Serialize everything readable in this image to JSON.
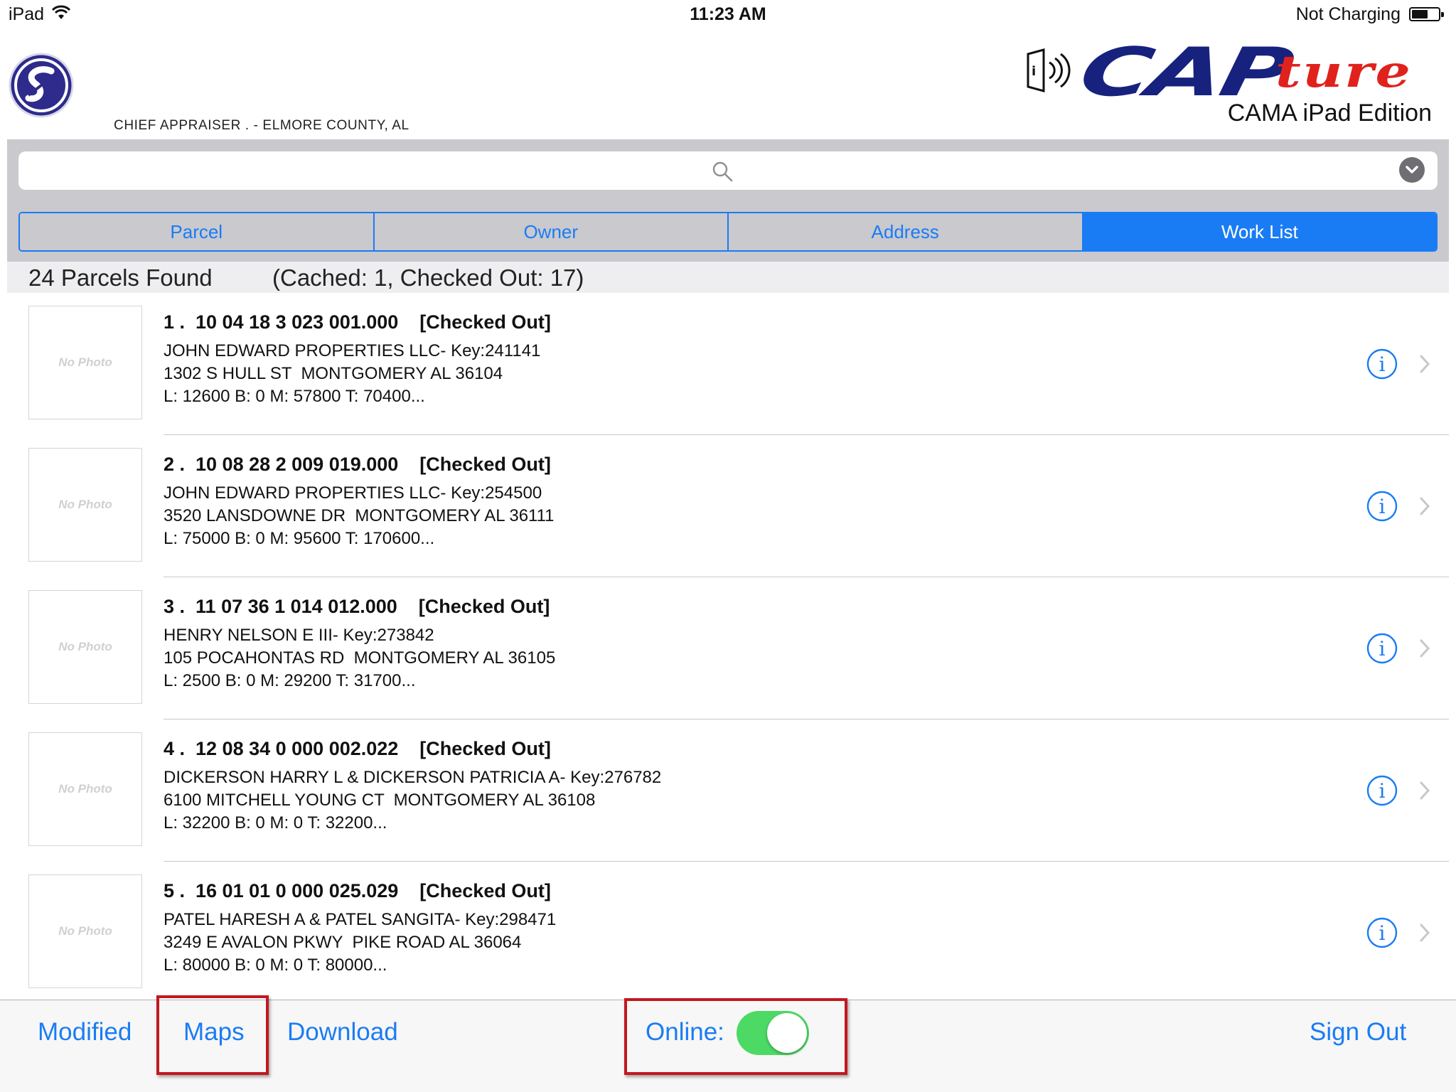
{
  "status_bar": {
    "device": "iPad",
    "time": "11:23 AM",
    "charging": "Not Charging"
  },
  "header": {
    "org_name": "CHIEF APPRAISER . - ELMORE COUNTY, AL",
    "brand_primary": "CAP",
    "brand_script": "ture",
    "edition": "CAMA iPad Edition"
  },
  "search": {
    "placeholder": ""
  },
  "tabs": [
    {
      "label": "Parcel",
      "active": false
    },
    {
      "label": "Owner",
      "active": false
    },
    {
      "label": "Address",
      "active": false
    },
    {
      "label": "Work List",
      "active": true
    }
  ],
  "results": {
    "count_text": "24  Parcels Found",
    "cache_text": "(Cached: 1, Checked Out: 17)"
  },
  "parcels": [
    {
      "title": "1 .  10 04 18 3 023 001.000    [Checked Out]",
      "owner": "JOHN EDWARD PROPERTIES LLC- Key:241141",
      "address": "1302 S HULL ST  MONTGOMERY AL 36104",
      "values": "L: 12600 B: 0 M: 57800 T: 70400...",
      "photo": "No Photo"
    },
    {
      "title": "2 .  10 08 28 2 009 019.000    [Checked Out]",
      "owner": "JOHN EDWARD PROPERTIES LLC- Key:254500",
      "address": "3520 LANSDOWNE DR  MONTGOMERY AL 36111",
      "values": "L: 75000 B: 0 M: 95600 T: 170600...",
      "photo": "No Photo"
    },
    {
      "title": "3 .  11 07 36 1 014 012.000    [Checked Out]",
      "owner": "HENRY NELSON E III- Key:273842",
      "address": "105 POCAHONTAS RD  MONTGOMERY AL 36105",
      "values": "L: 2500 B: 0 M: 29200 T: 31700...",
      "photo": "No Photo"
    },
    {
      "title": "4 .  12 08 34 0 000 002.022    [Checked Out]",
      "owner": "DICKERSON HARRY L & DICKERSON PATRICIA A- Key:276782",
      "address": "6100 MITCHELL YOUNG CT  MONTGOMERY AL 36108",
      "values": "L: 32200 B: 0 M: 0 T: 32200...",
      "photo": "No Photo"
    },
    {
      "title": "5 .  16 01 01 0 000 025.029    [Checked Out]",
      "owner": "PATEL HARESH A & PATEL SANGITA- Key:298471",
      "address": "3249 E AVALON PKWY  PIKE ROAD AL 36064",
      "values": "L: 80000 B: 0 M: 0 T: 80000...",
      "photo": "No Photo"
    }
  ],
  "toolbar": {
    "modified": "Modified",
    "maps": "Maps",
    "download": "Download",
    "online_label": "Online:",
    "online_on": true,
    "sign_out": "Sign Out"
  },
  "colors": {
    "accent": "#1a7cf4",
    "brand_blue": "#17217e",
    "brand_red": "#e0221d",
    "toggle_on": "#4cd964",
    "highlight": "#c2181e"
  },
  "icons": [
    "wifi-icon",
    "battery-icon",
    "app-logo",
    "nfc-reader-icon",
    "search-icon",
    "chevron-down-icon",
    "info-icon",
    "chevron-right-icon"
  ]
}
